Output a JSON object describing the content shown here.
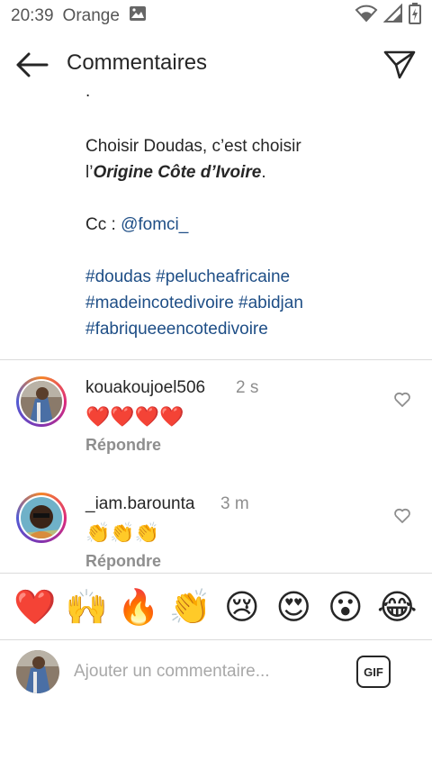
{
  "status_bar": {
    "time": "20:39",
    "carrier": "Orange"
  },
  "header": {
    "title": "Commentaires"
  },
  "caption": {
    "dot": ".",
    "line1": "Choisir Doudas, c’est choisir",
    "line2_prefix": "l’",
    "line2_bold": "Origine Côte d’Ivoire",
    "line2_suffix": ".",
    "cc_prefix": "Cc : ",
    "cc_mention": "@fomci_",
    "hashtags_line1": "#doudas #pelucheafricaine",
    "hashtags_line2": "#madeincotedivoire #abidjan",
    "hashtags_line3": "#fabriqueeencotedivoire"
  },
  "comments": [
    {
      "username": "kouakoujoel506",
      "time": "2 s",
      "text": "❤️❤️❤️❤️",
      "reply_label": "Répondre"
    },
    {
      "username": "_iam.barounta",
      "time": "3 m",
      "text": "👏👏👏",
      "reply_label": "Répondre"
    }
  ],
  "emoji_bar": [
    "❤️",
    "🙌",
    "🔥",
    "👏",
    "😢",
    "😍",
    "😮",
    "😂"
  ],
  "composer": {
    "placeholder": "Ajouter un commentaire...",
    "gif_label": "GIF"
  },
  "colors": {
    "link": "#1e4e86",
    "muted": "#8e8e8e",
    "divider": "#dbdbdb"
  }
}
